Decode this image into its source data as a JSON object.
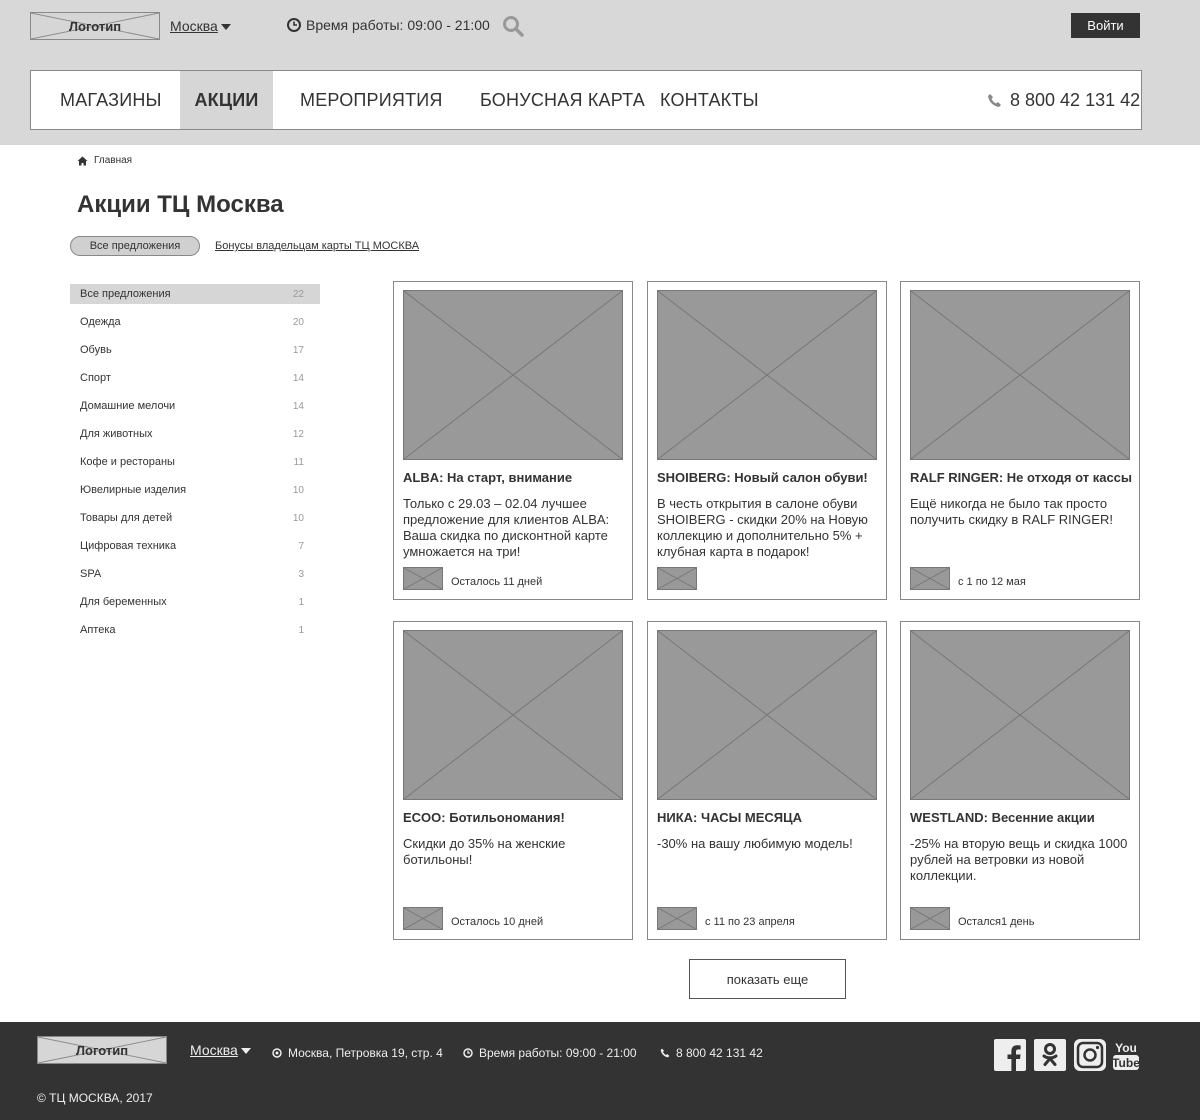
{
  "header": {
    "logo_text": "Логотип",
    "city": "Москва",
    "hours": "Время работы: 09:00 - 21:00",
    "login_label": "Войти",
    "phone": "8 800 42 131 42",
    "nav": [
      {
        "label": "МАГАЗИНЫ",
        "active": false
      },
      {
        "label": "АКЦИИ",
        "active": true
      },
      {
        "label": "МЕРОПРИЯТИЯ",
        "active": false
      },
      {
        "label": "БОНУСНАЯ КАРТА",
        "active": false
      },
      {
        "label": "КОНТАКТЫ",
        "active": false
      }
    ]
  },
  "breadcrumb": {
    "home": "Главная"
  },
  "page": {
    "title": "Акции ТЦ Москва",
    "filter_all": "Все предложения",
    "filter_bonus": "Бонусы владельцам карты ТЦ МОСКВА"
  },
  "sidebar": {
    "items": [
      {
        "label": "Все предложения",
        "count": "22",
        "active": true
      },
      {
        "label": "Одежда",
        "count": "20"
      },
      {
        "label": "Обувь",
        "count": "17"
      },
      {
        "label": "Спорт",
        "count": "14"
      },
      {
        "label": "Домашние мелочи",
        "count": "14"
      },
      {
        "label": "Для животных",
        "count": "12"
      },
      {
        "label": "Кофе и рестораны",
        "count": "11"
      },
      {
        "label": "Ювелирные изделия",
        "count": "10"
      },
      {
        "label": "Товары для детей",
        "count": "10"
      },
      {
        "label": "Цифровая техника",
        "count": "7"
      },
      {
        "label": "SPA",
        "count": "3"
      },
      {
        "label": "Для беременных",
        "count": "1"
      },
      {
        "label": "Аптека",
        "count": "1"
      }
    ]
  },
  "cards": [
    {
      "title": "ALBA: На старт, внимание",
      "desc": "Только с 29.03 – 02.04 лучшее предложение для клиентов ALBA: Ваша скидка по дисконтной карте умножается на три!",
      "meta": "Осталось 11 дней"
    },
    {
      "title": "SHOIBERG: Новый салон обуви!",
      "desc": "В честь открытия в салоне обуви SHOIBERG - скидки 20% на Новую коллекцию и дополнительно 5% + клубная карта в подарок!",
      "meta": ""
    },
    {
      "title": "RALF RINGER: Не отходя от кассы",
      "desc": "Ещё никогда не было так просто получить скидку в RALF RINGER!",
      "meta": "с 1 по 12 мая"
    },
    {
      "title": "ECOO: Ботильономания!",
      "desc": "Скидки до 35% на женские ботильоны!",
      "meta": "Осталось 10 дней"
    },
    {
      "title": "НИКА: ЧАСЫ МЕСЯЦА",
      "desc": "-30% на вашу любимую модель!",
      "meta": "с 11 по 23 апреля"
    },
    {
      "title": "WESTLAND: Весенние акции",
      "desc": "-25% на вторую вещь и скидка 1000 рублей на ветровки из новой коллекции.",
      "meta": "Остался1 день"
    }
  ],
  "show_more": "показать еще",
  "footer": {
    "logo_text": "Логотип",
    "city": "Москва",
    "address": "Москва, Петровка 19, стр. 4",
    "hours": "Время работы: 09:00 - 21:00",
    "phone": "8 800 42 131 42",
    "copyright": "© ТЦ МОСКВА, 2017"
  },
  "colors": {
    "header_bg": "#d8d8d8",
    "footer_bg": "#333333",
    "placeholder": "#999999",
    "active_bg": "#d6d6d6",
    "button_dark": "#333333"
  },
  "icons": [
    "clock-icon",
    "search-icon",
    "phone-icon",
    "home-icon",
    "location-icon",
    "facebook-icon",
    "odnoklassniki-icon",
    "instagram-icon",
    "youtube-icon"
  ]
}
